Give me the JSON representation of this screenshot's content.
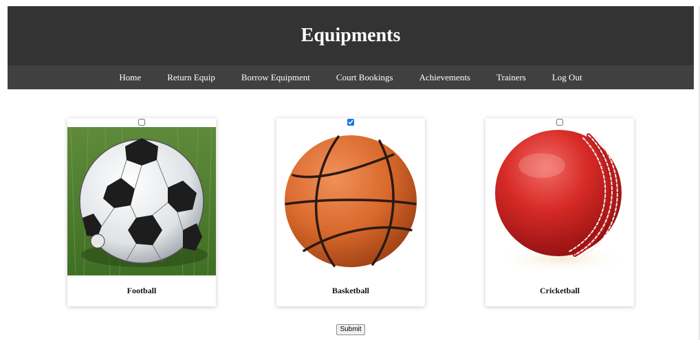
{
  "header": {
    "title": "Equipments"
  },
  "nav": {
    "items": [
      {
        "label": "Home"
      },
      {
        "label": "Return Equip"
      },
      {
        "label": "Borrow Equipment"
      },
      {
        "label": "Court Bookings"
      },
      {
        "label": "Achievements"
      },
      {
        "label": "Trainers"
      },
      {
        "label": "Log Out"
      }
    ]
  },
  "equipment": [
    {
      "name": "Football",
      "checked": false,
      "image_icon": "football-icon"
    },
    {
      "name": "Basketball",
      "checked": true,
      "image_icon": "basketball-icon"
    },
    {
      "name": "Cricketball",
      "checked": false,
      "image_icon": "cricketball-icon"
    }
  ],
  "form": {
    "submit_label": "Submit"
  },
  "colors": {
    "header_bg": "#333333",
    "nav_bg": "#404040",
    "nav_text": "#ffffff",
    "checkbox_accent": "#1a73e8"
  }
}
